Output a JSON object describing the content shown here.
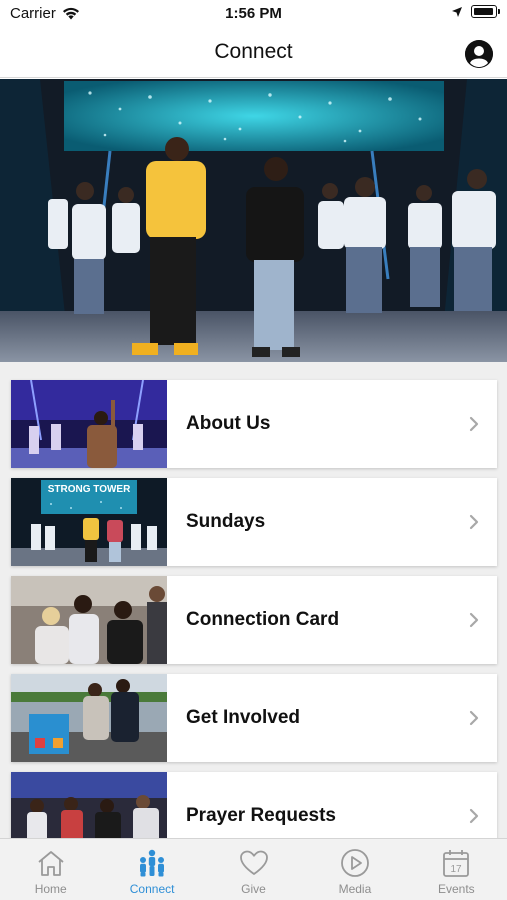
{
  "status_bar": {
    "carrier": "Carrier",
    "time": "1:56 PM"
  },
  "nav": {
    "title": "Connect"
  },
  "list": {
    "items": [
      {
        "label": "About Us"
      },
      {
        "label": "Sundays"
      },
      {
        "label": "Connection Card"
      },
      {
        "label": "Get Involved"
      },
      {
        "label": "Prayer Requests"
      }
    ]
  },
  "sundays_thumb_text": "STRONG TOWER",
  "tabs": [
    {
      "label": "Home",
      "icon": "house-icon",
      "active": false
    },
    {
      "label": "Connect",
      "icon": "people-icon",
      "active": true
    },
    {
      "label": "Give",
      "icon": "heart-icon",
      "active": false
    },
    {
      "label": "Media",
      "icon": "play-circle-icon",
      "active": false
    },
    {
      "label": "Events",
      "icon": "calendar-icon",
      "active": false
    }
  ],
  "events_icon_number": "17",
  "colors": {
    "accent": "#2f8fd6",
    "inactive": "#8e8e8e",
    "list_bg": "#efefef"
  }
}
